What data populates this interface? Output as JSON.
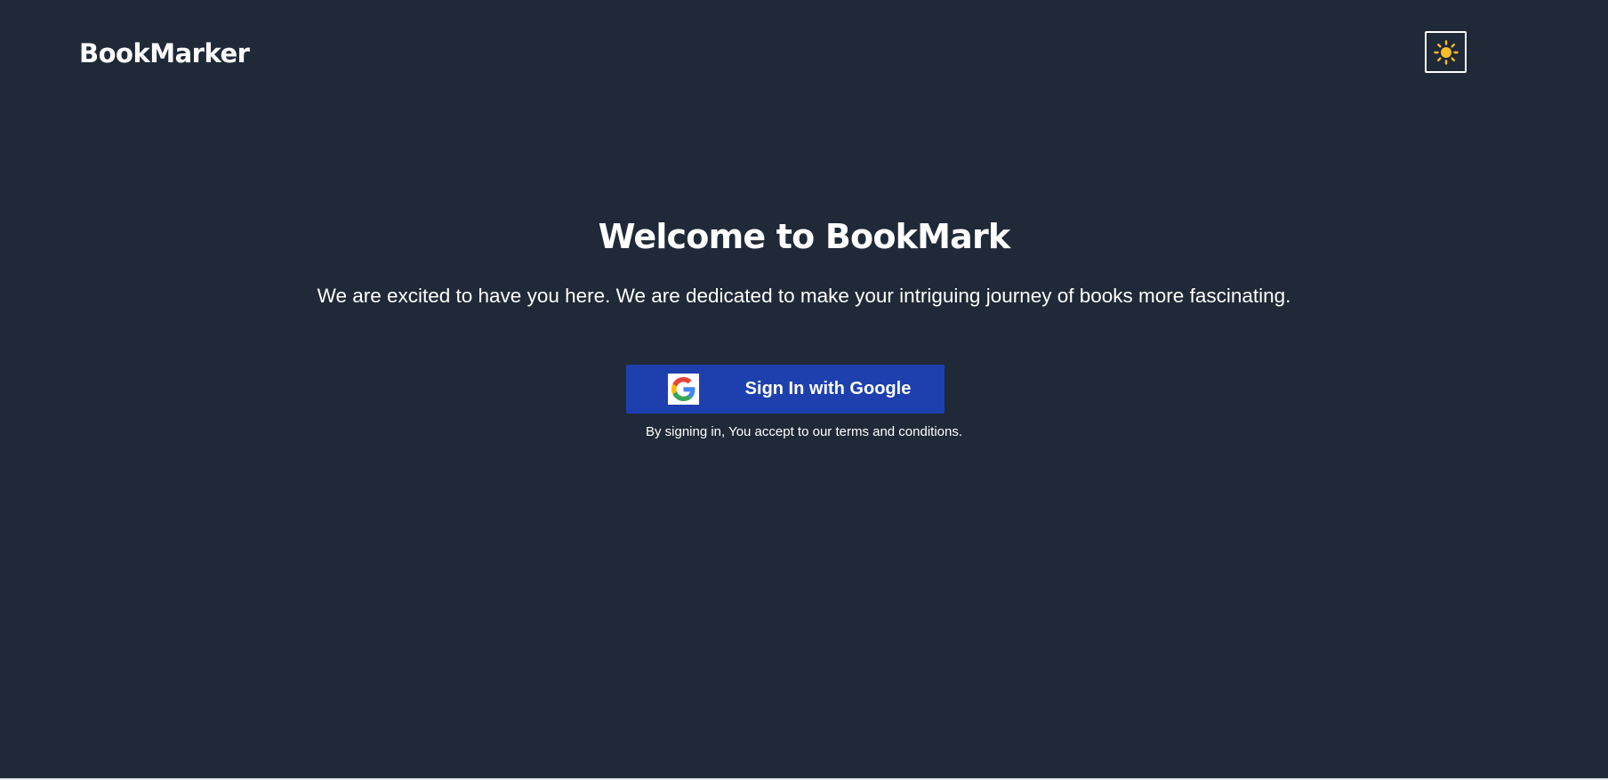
{
  "header": {
    "brand": "BookMarker",
    "theme_toggle": {
      "icon": "sun-icon",
      "icon_color": "#fbbf24"
    }
  },
  "hero": {
    "title": "Welcome to BookMark",
    "subtitle": "We are excited to have you here. We are dedicated to make your intriguing journey of books more fascinating."
  },
  "signin": {
    "button_label": "Sign In with Google",
    "button_icon": "google-icon",
    "button_color": "#1e40af",
    "terms_text": "By signing in, You accept to our terms and conditions."
  },
  "theme": {
    "background": "#1f2937",
    "text": "#ffffff"
  }
}
